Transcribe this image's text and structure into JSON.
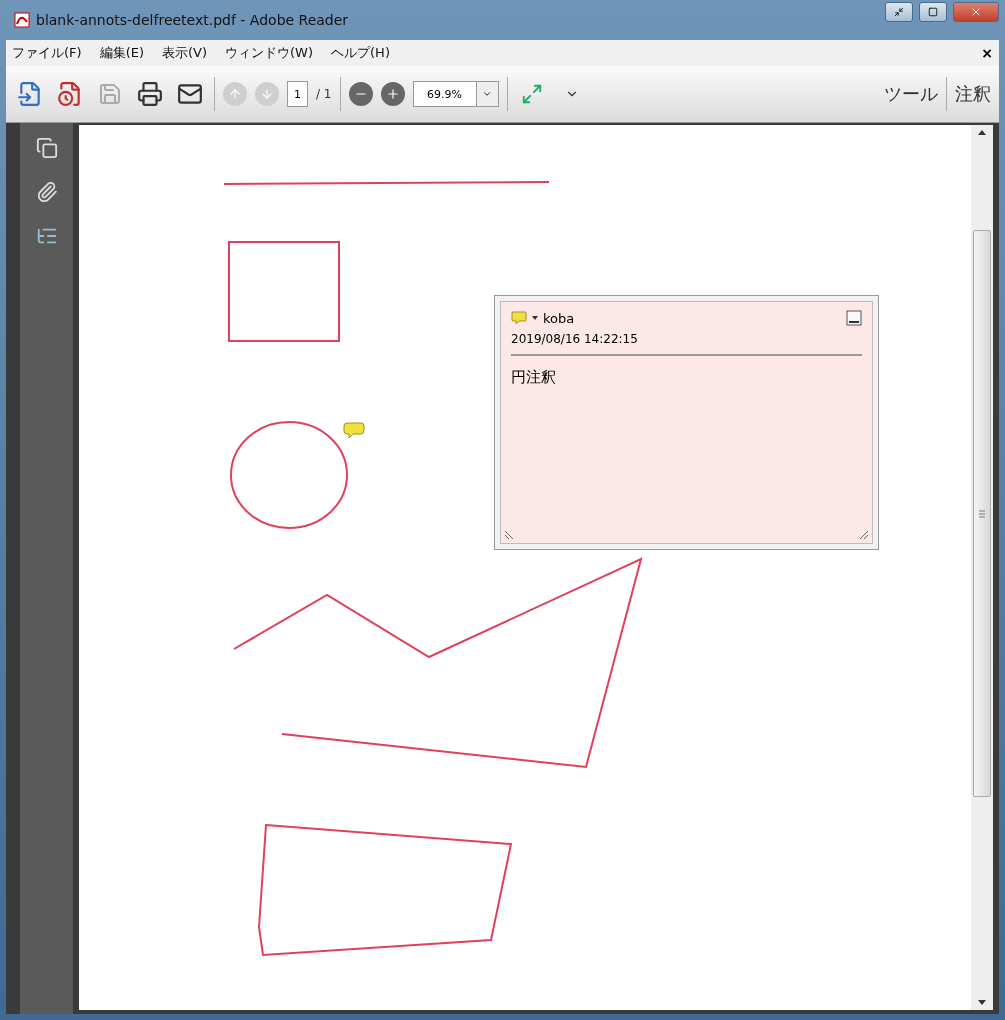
{
  "window": {
    "title": "blank-annots-delfreetext.pdf - Adobe Reader"
  },
  "menu": [
    "ファイル(F)",
    "編集(E)",
    "表示(V)",
    "ウィンドウ(W)",
    "ヘルプ(H)"
  ],
  "menu_close": "×",
  "toolbar": {
    "page": "1",
    "page_total": "/ 1",
    "zoom": "69.9%",
    "tools": "ツール",
    "comment": "注釈"
  },
  "page": {
    "annotations": [
      {
        "kind": "line"
      },
      {
        "kind": "square"
      },
      {
        "kind": "circle"
      },
      {
        "kind": "note"
      },
      {
        "kind": "polyline"
      },
      {
        "kind": "polygon"
      }
    ]
  },
  "popup": {
    "author": "koba",
    "date": "2019/08/16 14:22:15",
    "body": "円注釈"
  }
}
